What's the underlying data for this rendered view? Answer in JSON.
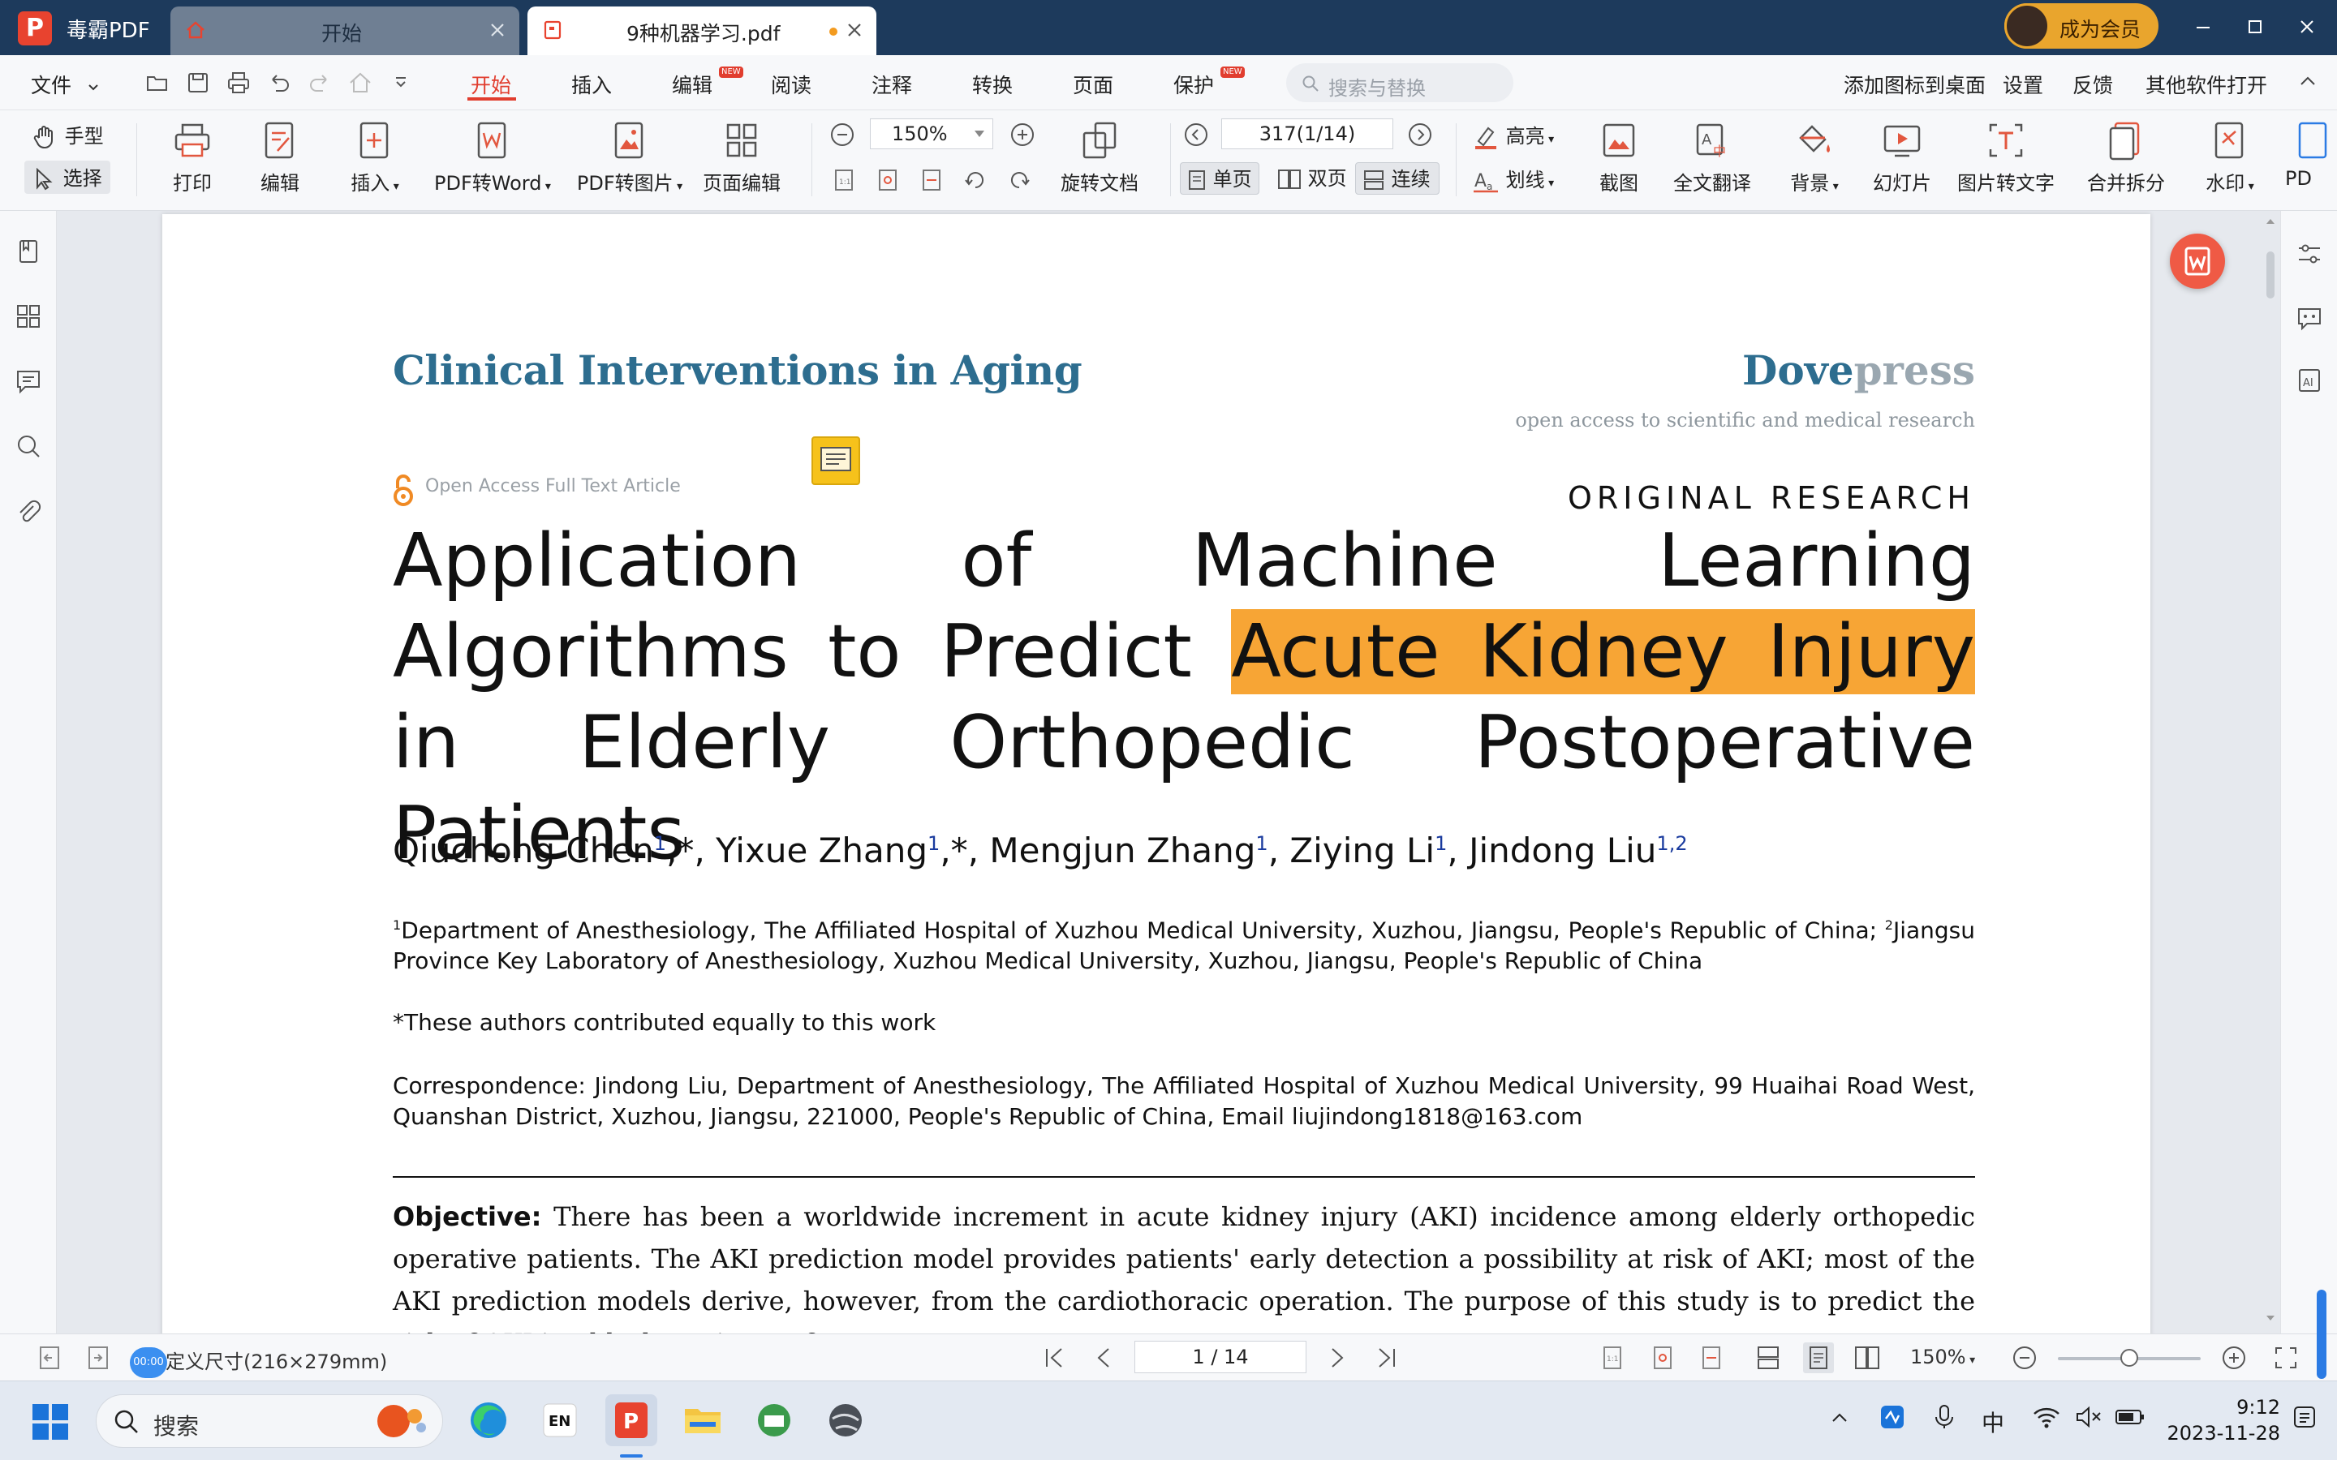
{
  "app": {
    "name": "毒霸PDF",
    "logo_letter": "P"
  },
  "tabs": [
    {
      "label": "开始",
      "active": false
    },
    {
      "label": "9种机器学习.pdf",
      "active": true,
      "modified": true
    }
  ],
  "member_button": "成为会员",
  "menubar": {
    "file": "文件",
    "items": [
      {
        "label": "开始",
        "active": true
      },
      {
        "label": "插入"
      },
      {
        "label": "编辑",
        "badge": "NEW"
      },
      {
        "label": "阅读"
      },
      {
        "label": "注释"
      },
      {
        "label": "转换"
      },
      {
        "label": "页面"
      },
      {
        "label": "保护",
        "badge": "NEW"
      }
    ],
    "search_placeholder": "搜索与替换",
    "right_items": [
      "添加图标到桌面",
      "设置",
      "反馈",
      "其他软件打开"
    ]
  },
  "ribbon": {
    "hand": "手型",
    "select": "选择",
    "print": "打印",
    "edit": "编辑",
    "insert": "插入",
    "pdf_to_word": "PDF转Word",
    "pdf_to_image": "PDF转图片",
    "page_edit": "页面编辑",
    "zoom": "150%",
    "rotate": "旋转文档",
    "page_input": "317(1/14)",
    "single": "单页",
    "double": "双页",
    "continuous": "连续",
    "highlight": "高亮",
    "strikethrough": "划线",
    "screenshot": "截图",
    "translate": "全文翻译",
    "background": "背景",
    "slideshow": "幻灯片",
    "ocr": "图片转文字",
    "merge_split": "合并拆分",
    "watermark": "水印",
    "more": "PD"
  },
  "document": {
    "journal": "Clinical Interventions in Aging",
    "publisher_a": "Dove",
    "publisher_b": "press",
    "publisher_tagline": "open access to scientific and medical research",
    "open_access": "Open Access Full Text Article",
    "article_type": "ORIGINAL RESEARCH",
    "title_pre": "Application of Machine Learning Algorithms to Predict ",
    "title_highlight": "Acute Kidney Injury",
    "title_post": " in Elderly Orthopedic Postoperative Patients",
    "authors": [
      {
        "name": "Qiuchong Chen",
        "sup": "1",
        "mark": ",*"
      },
      {
        "name": "Yixue Zhang",
        "sup": "1",
        "mark": ",*"
      },
      {
        "name": "Mengjun Zhang",
        "sup": "1",
        "mark": ""
      },
      {
        "name": "Ziying Li",
        "sup": "1",
        "mark": ""
      },
      {
        "name": "Jindong Liu",
        "sup": "1,2",
        "mark": ""
      }
    ],
    "affiliation_1": "Department of Anesthesiology, The Affiliated Hospital of Xuzhou Medical University, Xuzhou, Jiangsu, People's Republic of China; ",
    "affiliation_2": "Jiangsu Province Key Laboratory of Anesthesiology, Xuzhou Medical University, Xuzhou, Jiangsu, People's Republic of China",
    "equal_contribution": "*These authors contributed equally to this work",
    "correspondence": "Correspondence: Jindong Liu, Department of Anesthesiology, The Affiliated Hospital of Xuzhou Medical University, 99 Huaihai Road West, Quanshan District, Xuzhou, Jiangsu, 221000, People's Republic of China, Email liujindong1818@163.com",
    "objective_label": "Objective:",
    "objective_text": " There has been a worldwide increment in acute kidney injury (AKI) incidence among elderly orthopedic operative patients. The AKI prediction model provides patients' early detection a possibility at risk of AKI; most of the AKI prediction models derive, however, from the cardiothoracic operation. The purpose of this study is to predict the risk of AKI in elderly patients after"
  },
  "statusbar": {
    "time_badge": "00:00",
    "page_size": "定义尺寸(216×279mm)",
    "page_nav": "1 / 14",
    "zoom": "150%",
    "zoom_fraction": 0.5
  },
  "taskbar": {
    "search_placeholder": "搜索",
    "lang": "EN",
    "ime": "中",
    "time": "9:12",
    "date": "2023-11-28"
  }
}
